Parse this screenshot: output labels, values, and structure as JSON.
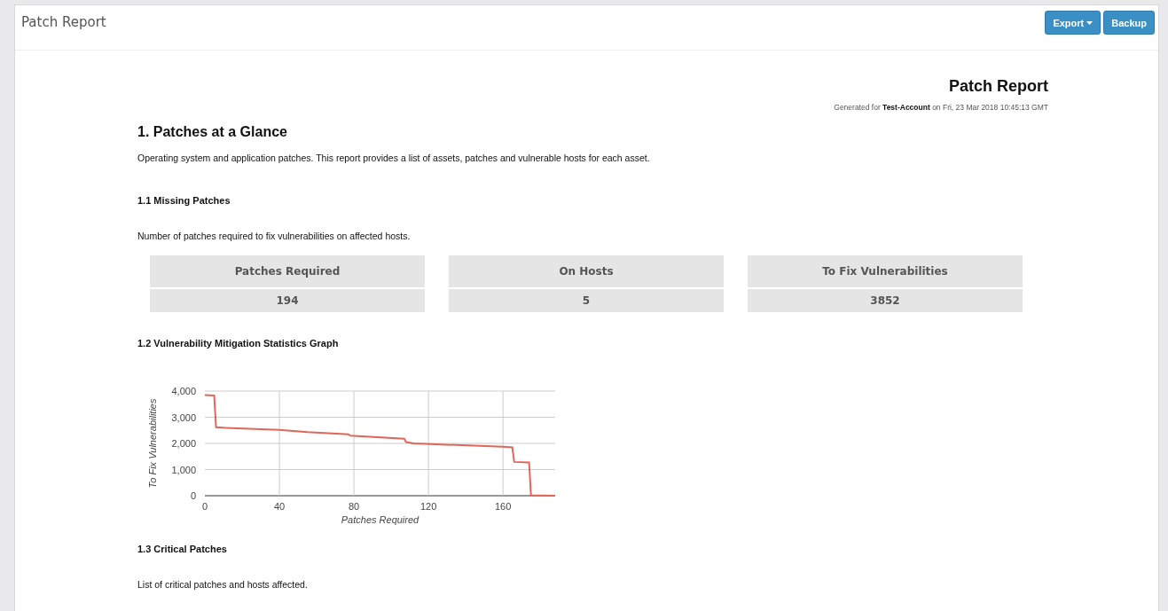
{
  "header": {
    "title": "Patch Report",
    "buttons": [
      {
        "label": "Export",
        "kind": "dropdown"
      },
      {
        "label": "Backup",
        "kind": "plain"
      }
    ]
  },
  "report": {
    "title": "Patch Report",
    "generated": "Generated for **Test-Account** on Fri, 23 Mar 2018 10:45:13 GMT",
    "section": {
      "heading": "1. Patches at a Glance",
      "description": "Operating system and application patches. This report provides a list of assets, patches and vulnerable hosts for each asset."
    },
    "missing": {
      "heading": "1.1 Missing Patches",
      "description": "Number of patches required to fix vulnerabilities on affected hosts.",
      "stats": [
        {
          "label": "Patches Required",
          "value": "194"
        },
        {
          "label": "On Hosts",
          "value": "5"
        },
        {
          "label": "To Fix Vulnerabilities",
          "value": "3852"
        }
      ]
    },
    "graph": {
      "heading": "1.2 Vulnerability Mitigation Statistics Graph",
      "chart_data": {
        "type": "line",
        "xlabel": "Patches Required",
        "ylabel": "To Fix Vulnerabilities",
        "x": [
          0,
          5,
          6,
          10,
          40,
          55,
          77,
          78,
          107,
          108,
          112,
          160,
          165,
          166,
          174,
          175,
          188
        ],
        "grid": true,
        "series": [
          {
            "color": "#e0665a",
            "values": [
              3850,
              3830,
              2620,
              2600,
              2520,
              2430,
              2350,
              2300,
              2180,
              2050,
              2000,
              1870,
              1850,
              1290,
              1270,
              20,
              0
            ]
          }
        ],
        "xlim": [
          0,
          188
        ],
        "ylim": [
          0,
          4000
        ],
        "xticks": [
          0,
          40,
          80,
          120,
          160
        ],
        "yticks": [
          {
            "value": 0,
            "label": "0"
          },
          {
            "value": 1000,
            "label": "1,000"
          },
          {
            "value": 2000,
            "label": "2,000"
          },
          {
            "value": 3000,
            "label": "3,000"
          },
          {
            "value": 4000,
            "label": "4,000"
          }
        ]
      }
    },
    "critical": {
      "heading": "1.3 Critical Patches",
      "description": "List of critical patches and hosts affected."
    }
  }
}
